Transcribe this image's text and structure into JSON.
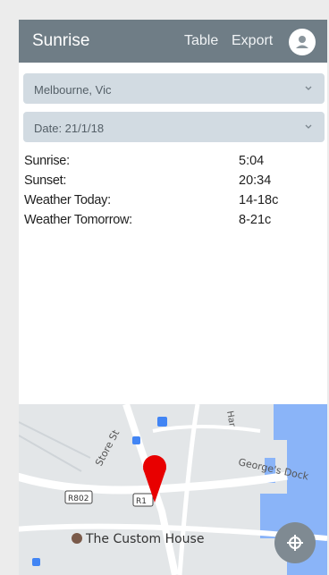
{
  "appbar": {
    "title": "Sunrise",
    "table_label": "Table",
    "export_label": "Export",
    "avatar_icon": "user-icon"
  },
  "location_select": {
    "value": "Melbourne, Vic",
    "icon": "chevron-down-icon"
  },
  "date_select": {
    "value": "Date: 21/1/18",
    "icon": "chevron-down-icon"
  },
  "info": [
    {
      "label": "Sunrise:",
      "value": "5:04"
    },
    {
      "label": "Sunset:",
      "value": "20:34"
    },
    {
      "label": "Weather Today:",
      "value": "14-18c"
    },
    {
      "label": "Weather Tomorrow:",
      "value": "8-21c"
    }
  ],
  "map": {
    "streets": [
      "Store St",
      "George's Dock",
      "Har"
    ],
    "route_shields": [
      "R802",
      "R1"
    ],
    "poi": "The Custom House",
    "marker_color": "#e80000",
    "water_color": "#8ab4f8",
    "land_color": "#e3e6e8"
  },
  "fab_icon": "locate-icon",
  "colors": {
    "appbar": "#6f7d86",
    "select_bg": "#d2dbe2"
  }
}
